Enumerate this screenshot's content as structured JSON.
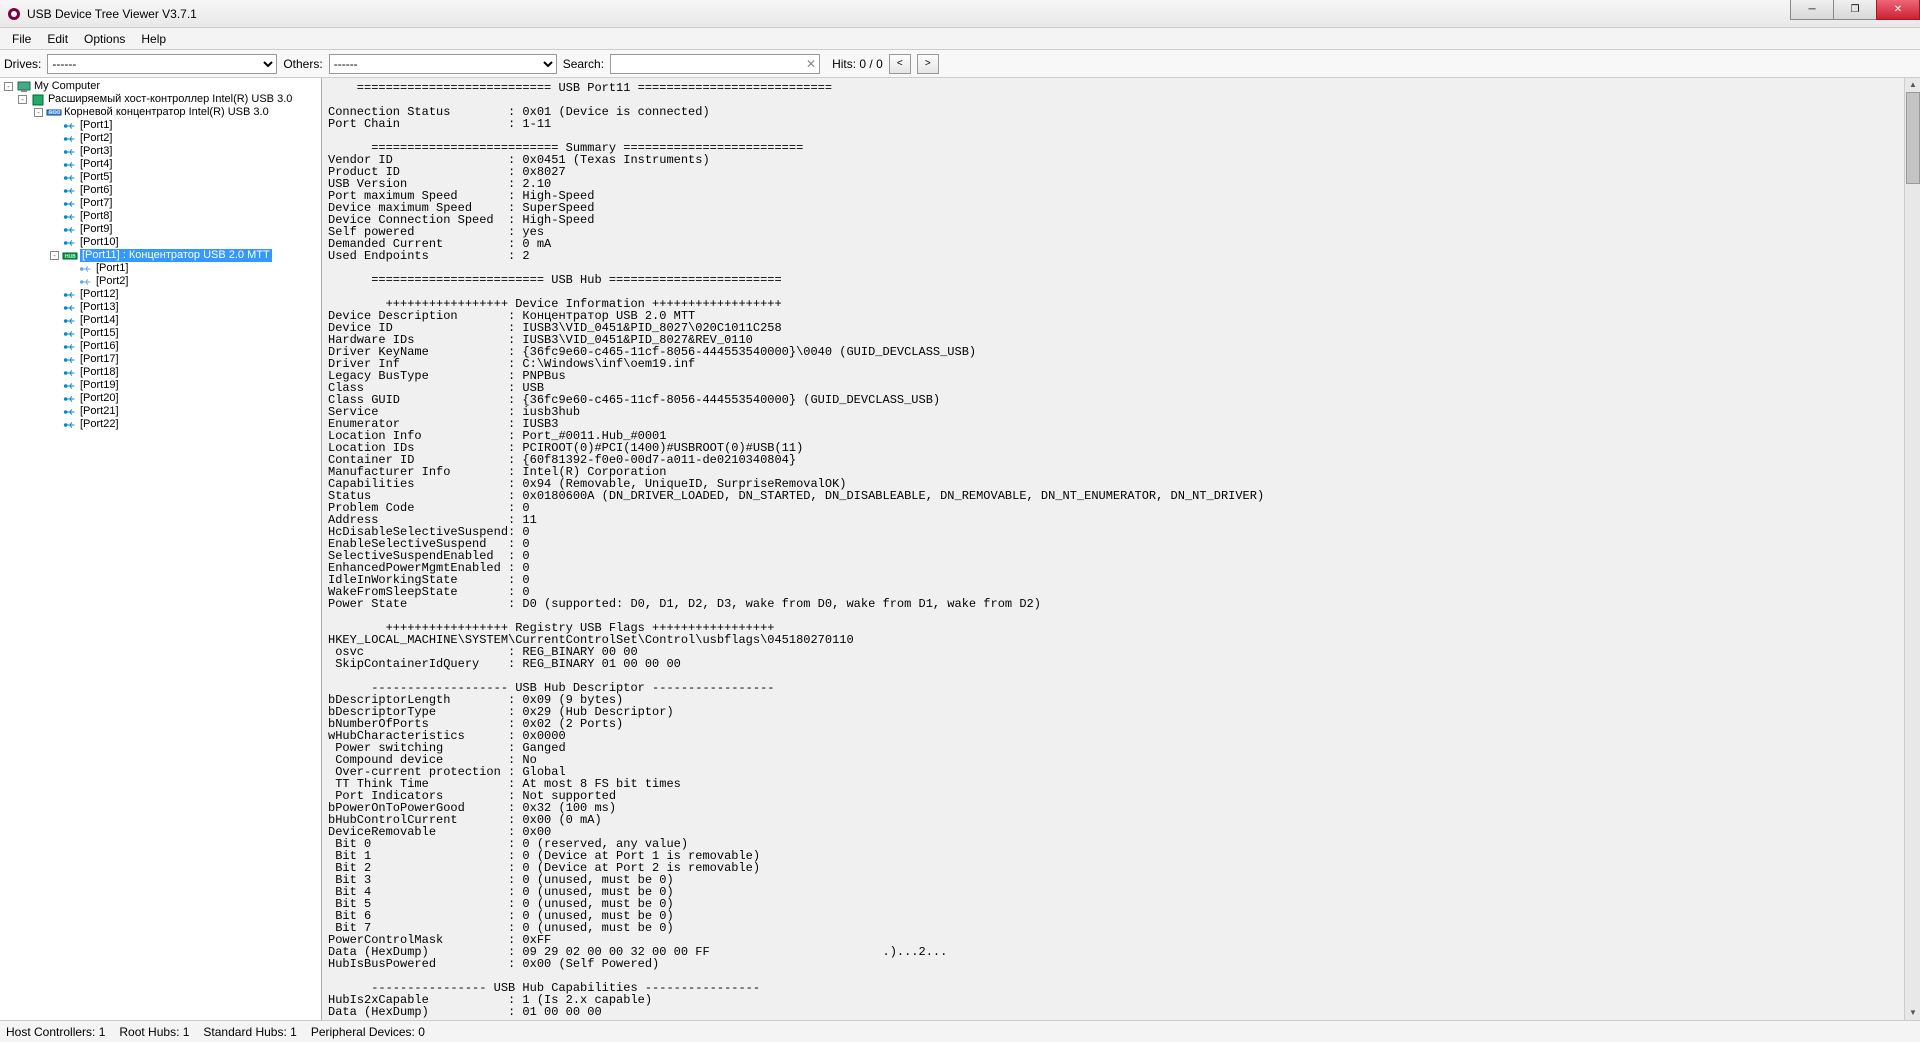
{
  "window": {
    "title": "USB Device Tree Viewer V3.7.1"
  },
  "menu": {
    "file": "File",
    "edit": "Edit",
    "options": "Options",
    "help": "Help"
  },
  "toolbar": {
    "drives_lbl": "Drives:",
    "drives_val": "------",
    "others_lbl": "Others:",
    "others_val": "------",
    "search_lbl": "Search:",
    "hits": "Hits: 0 / 0",
    "prev": "<",
    "next": ">"
  },
  "tree": {
    "root": "My Computer",
    "hc": "Расширяемый хост-контроллер Intel(R) USB 3.0",
    "rh": "Корневой концентратор Intel(R) USB 3.0",
    "p1": "[Port1]",
    "p2": "[Port2]",
    "p3": "[Port3]",
    "p4": "[Port4]",
    "p5": "[Port5]",
    "p6": "[Port6]",
    "p7": "[Port7]",
    "p8": "[Port8]",
    "p9": "[Port9]",
    "p10": "[Port10]",
    "p11": "[Port11] : Концентратор USB 2.0 MTT",
    "p11_1": "[Port1]",
    "p11_2": "[Port2]",
    "p12": "[Port12]",
    "p13": "[Port13]",
    "p14": "[Port14]",
    "p15": "[Port15]",
    "p16": "[Port16]",
    "p17": "[Port17]",
    "p18": "[Port18]",
    "p19": "[Port19]",
    "p20": "[Port20]",
    "p21": "[Port21]",
    "p22": "[Port22]"
  },
  "details": "    =========================== USB Port11 ===========================\n\nConnection Status        : 0x01 (Device is connected)\nPort Chain               : 1-11\n\n      ========================== Summary =========================\nVendor ID                : 0x0451 (Texas Instruments)\nProduct ID               : 0x8027\nUSB Version              : 2.10\nPort maximum Speed       : High-Speed\nDevice maximum Speed     : SuperSpeed\nDevice Connection Speed  : High-Speed\nSelf powered             : yes\nDemanded Current         : 0 mA\nUsed Endpoints           : 2\n\n      ======================== USB Hub ========================\n\n        +++++++++++++++++ Device Information ++++++++++++++++++\nDevice Description       : Концентратор USB 2.0 MTT\nDevice ID                : IUSB3\\VID_0451&PID_8027\\020C1011C258\nHardware IDs             : IUSB3\\VID_0451&PID_8027&REV_0110\nDriver KeyName           : {36fc9e60-c465-11cf-8056-444553540000}\\0040 (GUID_DEVCLASS_USB)\nDriver Inf               : C:\\Windows\\inf\\oem19.inf\nLegacy BusType           : PNPBus\nClass                    : USB\nClass GUID               : {36fc9e60-c465-11cf-8056-444553540000} (GUID_DEVCLASS_USB)\nService                  : iusb3hub\nEnumerator               : IUSB3\nLocation Info            : Port_#0011.Hub_#0001\nLocation IDs             : PCIROOT(0)#PCI(1400)#USBROOT(0)#USB(11)\nContainer ID             : {60f81392-f0e0-00d7-a011-de0210340804}\nManufacturer Info        : Intel(R) Corporation\nCapabilities             : 0x94 (Removable, UniqueID, SurpriseRemovalOK)\nStatus                   : 0x0180600A (DN_DRIVER_LOADED, DN_STARTED, DN_DISABLEABLE, DN_REMOVABLE, DN_NT_ENUMERATOR, DN_NT_DRIVER)\nProblem Code             : 0\nAddress                  : 11\nHcDisableSelectiveSuspend: 0\nEnableSelectiveSuspend   : 0\nSelectiveSuspendEnabled  : 0\nEnhancedPowerMgmtEnabled : 0\nIdleInWorkingState       : 0\nWakeFromSleepState       : 0\nPower State              : D0 (supported: D0, D1, D2, D3, wake from D0, wake from D1, wake from D2)\n\n        +++++++++++++++++ Registry USB Flags +++++++++++++++++\nHKEY_LOCAL_MACHINE\\SYSTEM\\CurrentControlSet\\Control\\usbflags\\045180270110\n osvc                    : REG_BINARY 00 00\n SkipContainerIdQuery    : REG_BINARY 01 00 00 00\n\n      ------------------- USB Hub Descriptor -----------------\nbDescriptorLength        : 0x09 (9 bytes)\nbDescriptorType          : 0x29 (Hub Descriptor)\nbNumberOfPorts           : 0x02 (2 Ports)\nwHubCharacteristics      : 0x0000\n Power switching         : Ganged\n Compound device         : No\n Over-current protection : Global\n TT Think Time           : At most 8 FS bit times\n Port Indicators         : Not supported\nbPowerOnToPowerGood      : 0x32 (100 ms)\nbHubControlCurrent       : 0x00 (0 mA)\nDeviceRemovable          : 0x00\n Bit 0                   : 0 (reserved, any value)\n Bit 1                   : 0 (Device at Port 1 is removable)\n Bit 2                   : 0 (Device at Port 2 is removable)\n Bit 3                   : 0 (unused, must be 0)\n Bit 4                   : 0 (unused, must be 0)\n Bit 5                   : 0 (unused, must be 0)\n Bit 6                   : 0 (unused, must be 0)\n Bit 7                   : 0 (unused, must be 0)\nPowerControlMask         : 0xFF\nData (HexDump)           : 09 29 02 00 00 32 00 00 FF                        .)...2...\nHubIsBusPowered          : 0x00 (Self Powered)\n\n      ---------------- USB Hub Capabilities ----------------\nHubIs2xCapable           : 1 (Is 2.x capable)\nData (HexDump)           : 01 00 00 00",
  "status": {
    "hc": "Host Controllers: 1",
    "rh": "Root Hubs: 1",
    "sh": "Standard Hubs: 1",
    "pd": "Peripheral Devices: 0"
  }
}
